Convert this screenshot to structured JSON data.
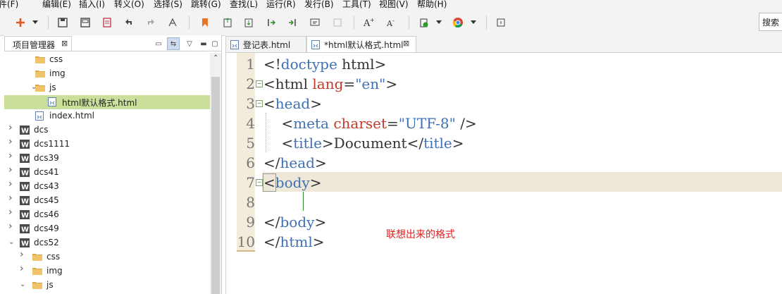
{
  "menu": [
    "件(F)",
    "编辑(E)",
    "插入(I)",
    "转义(O)",
    "选择(S)",
    "跳转(G)",
    "查找(L)",
    "运行(R)",
    "发行(B)",
    "工具(T)",
    "视图(V)",
    "帮助(H)"
  ],
  "toolbar": {
    "search_label": "搜索",
    "icons": [
      "new-icon",
      "dropdown-arrow-icon",
      "save-icon",
      "save-all-icon",
      "revert-icon",
      "undo-icon",
      "redo-icon",
      "format-icon",
      "bookmark-icon",
      "export-icon",
      "import-icon",
      "step-in-icon",
      "step-out-icon",
      "comment-icon",
      "disabled-icon",
      "font-increase-icon",
      "font-decrease-icon",
      "run-icon",
      "dropdown-arrow-icon",
      "browser-icon",
      "dropdown-arrow-icon",
      "help-icon"
    ]
  },
  "project_panel": {
    "tab_label": "项目管理器",
    "tree": [
      {
        "label": "css",
        "type": "folder",
        "level": 2,
        "chevron": ""
      },
      {
        "label": "img",
        "type": "folder",
        "level": 2,
        "chevron": ""
      },
      {
        "label": "js",
        "type": "folder",
        "level": 2,
        "chevron": "down"
      },
      {
        "label": "html默认格式.html",
        "type": "file",
        "level": 3,
        "chevron": "",
        "selected": true
      },
      {
        "label": "index.html",
        "type": "file",
        "level": 2,
        "chevron": ""
      },
      {
        "label": "dcs",
        "type": "project",
        "level": 0,
        "chevron": "right"
      },
      {
        "label": "dcs1111",
        "type": "project",
        "level": 0,
        "chevron": "right"
      },
      {
        "label": "dcs39",
        "type": "project",
        "level": 0,
        "chevron": "right"
      },
      {
        "label": "dcs41",
        "type": "project",
        "level": 0,
        "chevron": "right"
      },
      {
        "label": "dcs43",
        "type": "project",
        "level": 0,
        "chevron": "right"
      },
      {
        "label": "dcs45",
        "type": "project",
        "level": 0,
        "chevron": "right"
      },
      {
        "label": "dcs46",
        "type": "project",
        "level": 0,
        "chevron": "right"
      },
      {
        "label": "dcs49",
        "type": "project",
        "level": 0,
        "chevron": "right"
      },
      {
        "label": "dcs52",
        "type": "project",
        "level": 0,
        "chevron": "down"
      },
      {
        "label": "css",
        "type": "folder",
        "level": 1,
        "chevron": "right"
      },
      {
        "label": "img",
        "type": "folder",
        "level": 1,
        "chevron": "right"
      },
      {
        "label": "js",
        "type": "folder",
        "level": 1,
        "chevron": "down"
      }
    ]
  },
  "editor": {
    "tabs": [
      {
        "label": "登记表.html",
        "active": false
      },
      {
        "label": "*html默认格式.html",
        "active": true
      }
    ],
    "lines": [
      {
        "n": "1",
        "fold": false
      },
      {
        "n": "2",
        "fold": true
      },
      {
        "n": "3",
        "fold": true
      },
      {
        "n": "4",
        "fold": false
      },
      {
        "n": "5",
        "fold": false
      },
      {
        "n": "6",
        "fold": false
      },
      {
        "n": "7",
        "fold": true
      },
      {
        "n": "8",
        "fold": false
      },
      {
        "n": "9",
        "fold": false
      },
      {
        "n": "10",
        "fold": false
      }
    ],
    "code": {
      "l1": {
        "open": "<!",
        "tag": "doctype",
        "rest": " html>"
      },
      "l2": {
        "open": "<",
        "tag": "html",
        "attr": "lang",
        "eq": "=",
        "val": "\"en\"",
        "close": ">"
      },
      "l3": {
        "open": "<",
        "tag": "head",
        "close": ">"
      },
      "l4": {
        "indent": "    ",
        "open": "<",
        "tag": "meta",
        "attr": "charset",
        "eq": "=",
        "val": "\"UTF-8\"",
        "close": " />"
      },
      "l5": {
        "indent": "    ",
        "open": "<",
        "tag": "title",
        "close": ">",
        "text": "Document",
        "open2": "</",
        "tag2": "title",
        "close2": ">"
      },
      "l6": {
        "open": "</",
        "tag": "head",
        "close": ">"
      },
      "l7": {
        "open": "<",
        "tag": "body",
        "close": ">"
      },
      "l9": {
        "open": "</",
        "tag": "body",
        "close": ">"
      },
      "l10": {
        "open": "</",
        "tag": "html",
        "close": ">"
      }
    },
    "annotation": "联想出来的格式"
  },
  "colors": {
    "tag": "#3f6fb5",
    "attr": "#c0392b",
    "selection": "#c9df9a",
    "current_line": "#eee8d8",
    "annotation": "#e02020"
  }
}
